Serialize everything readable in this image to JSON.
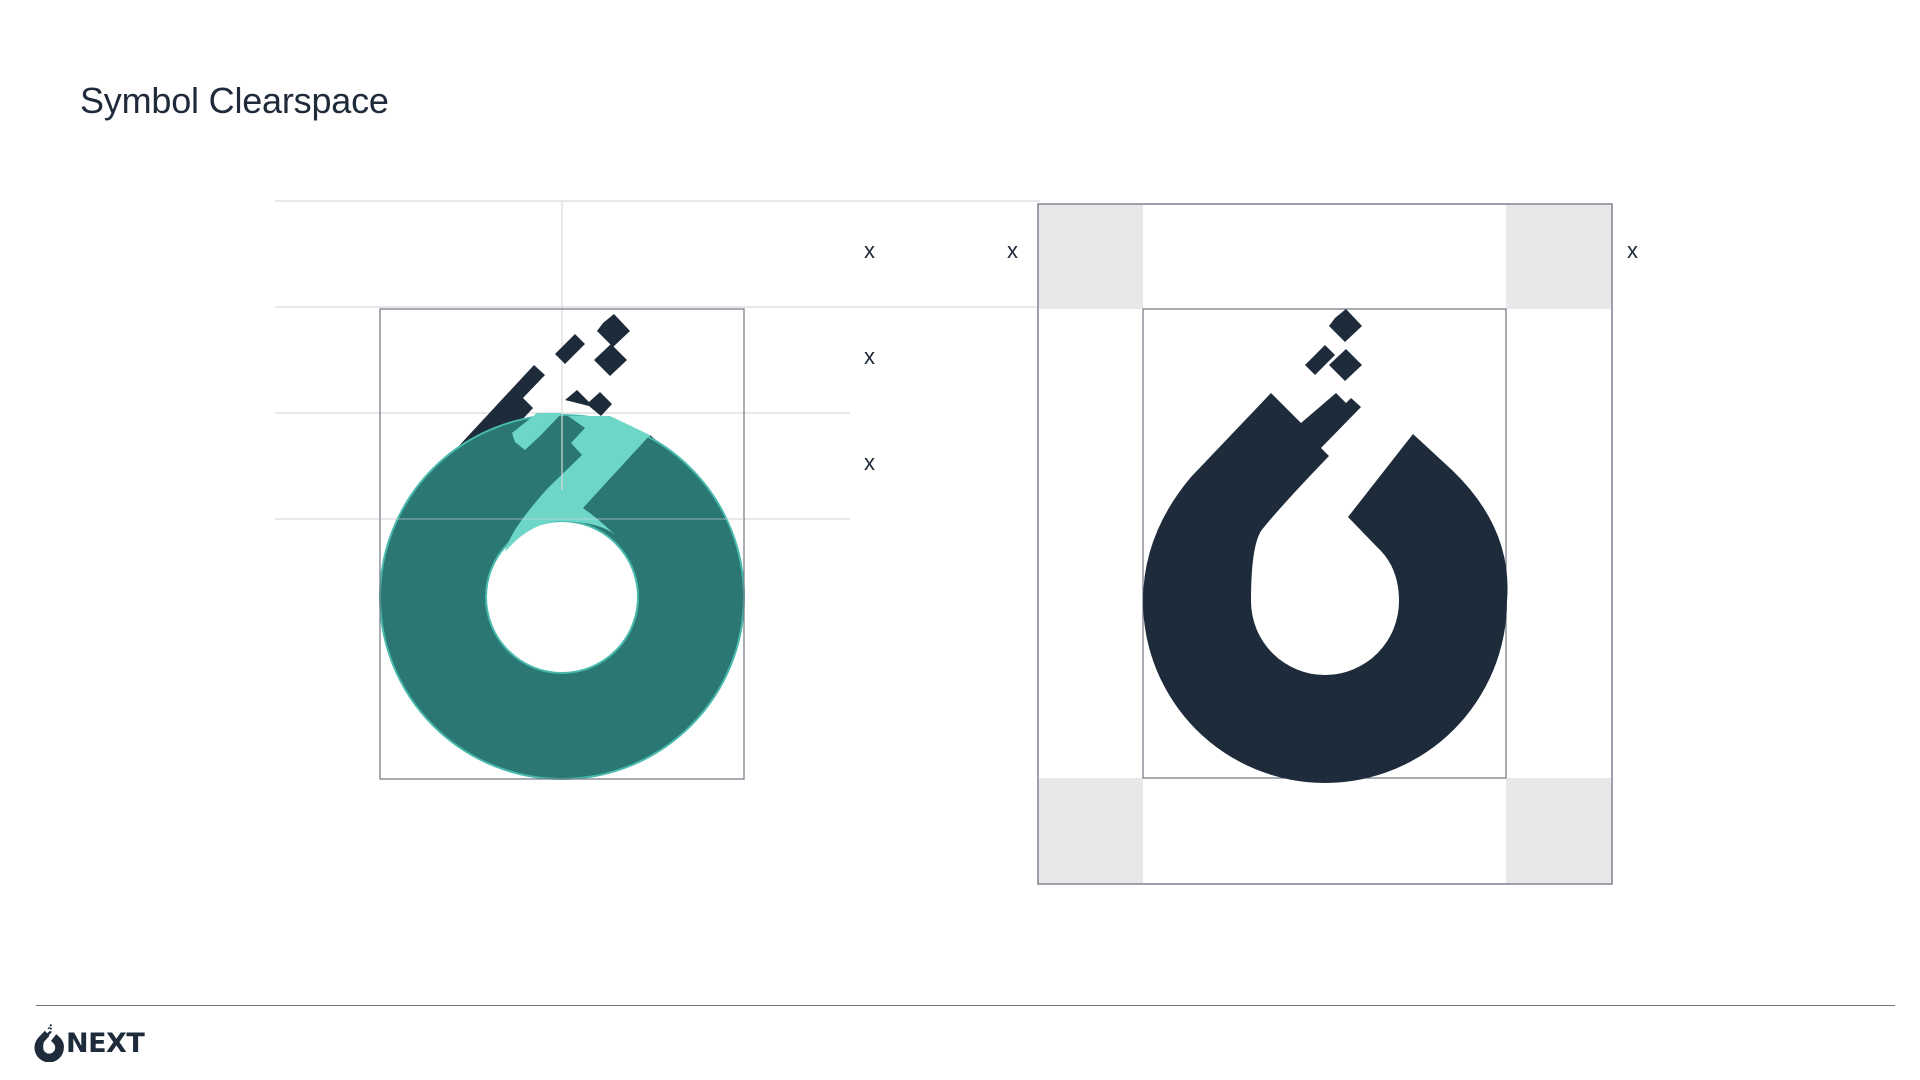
{
  "page": {
    "title": "Symbol Clearspace"
  },
  "diagram": {
    "unit_label": "x",
    "unit_labels": [
      "x",
      "x",
      "x",
      "x",
      "x"
    ]
  },
  "colors": {
    "navy": "#1e2b3b",
    "teal": "#2a7773",
    "mint": "#6dd6c7",
    "clearspace_gray": "#e8e8eb",
    "guide_line": "#d9dadd",
    "frame_line": "#6f7580"
  },
  "footer": {
    "brand_wordmark": "NEXT",
    "brand_icon": "onext-droplet-icon"
  }
}
